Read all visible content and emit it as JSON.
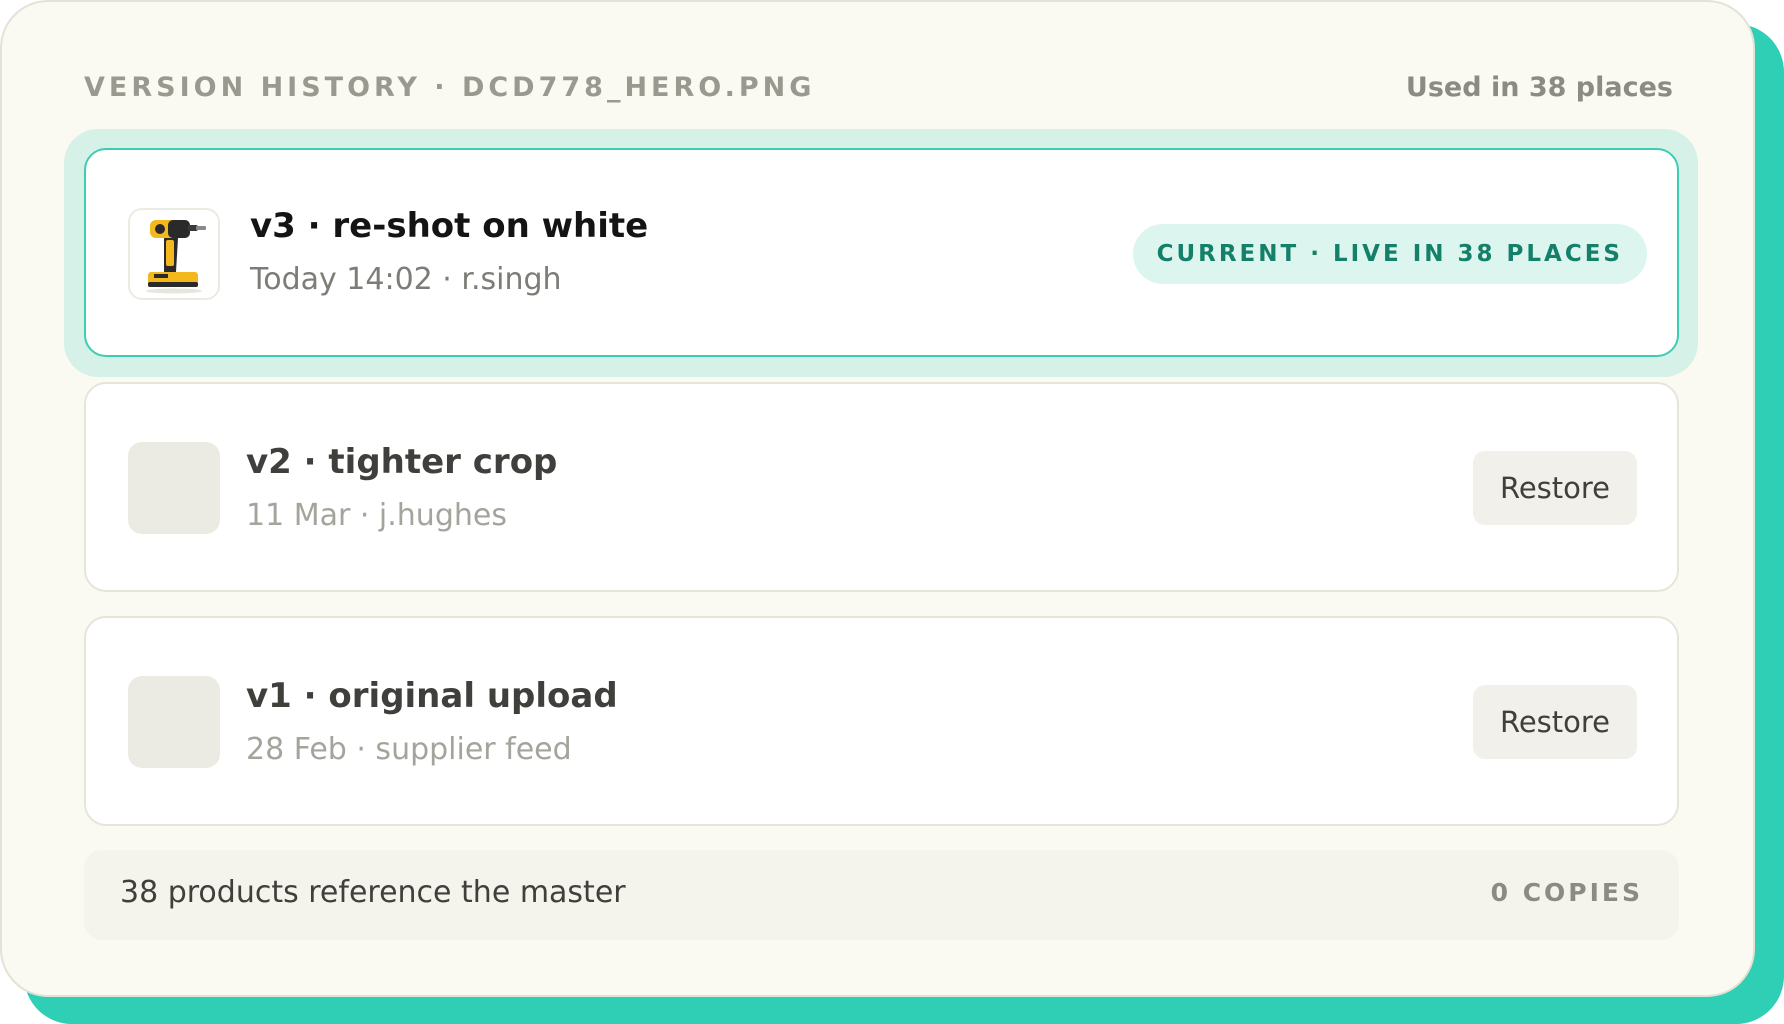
{
  "header": {
    "title": "VERSION HISTORY · DCD778_HERO.PNG",
    "usage": "Used in 38 places"
  },
  "versions": [
    {
      "title": "v3 · re-shot on white",
      "meta": "Today 14:02 · r.singh",
      "badge": "CURRENT · LIVE IN 38 PLACES",
      "thumbnail": "drill-product-photo"
    },
    {
      "title": "v2 · tighter crop",
      "meta": "11 Mar · j.hughes",
      "action_label": "Restore"
    },
    {
      "title": "v1 · original upload",
      "meta": "28 Feb · supplier feed",
      "action_label": "Restore"
    }
  ],
  "footer": {
    "text": "38 products reference the master",
    "copies": "0 COPIES"
  },
  "colors": {
    "accent": "#2ecfb4",
    "badge_text": "#14806a",
    "badge_bg": "#dcf5ee",
    "card_bg": "#fbfaf2"
  }
}
